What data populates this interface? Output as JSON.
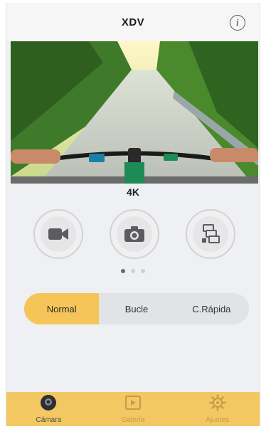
{
  "header": {
    "title": "XDV",
    "info_icon": "info-icon"
  },
  "preview": {
    "description_icon": "camera-preview"
  },
  "resolution": "4K",
  "modes": [
    {
      "id": "video",
      "icon": "video-camera-icon"
    },
    {
      "id": "photo",
      "icon": "photo-camera-icon"
    },
    {
      "id": "burst",
      "icon": "burst-icon"
    }
  ],
  "pager": {
    "count": 3,
    "active": 0
  },
  "segments": [
    {
      "label": "Normal",
      "active": true
    },
    {
      "label": "Bucle",
      "active": false
    },
    {
      "label": "C.Rápida",
      "active": false
    }
  ],
  "tabbar": {
    "items": [
      {
        "label": "Cámara",
        "icon": "camera-tab-icon",
        "active": true
      },
      {
        "label": "Galería",
        "icon": "gallery-tab-icon",
        "active": false
      },
      {
        "label": "Ajustes",
        "icon": "settings-tab-icon",
        "active": false
      }
    ]
  },
  "colors": {
    "accent": "#f5c55a",
    "tabbar": "#f3c762",
    "background": "#eef0f3"
  }
}
